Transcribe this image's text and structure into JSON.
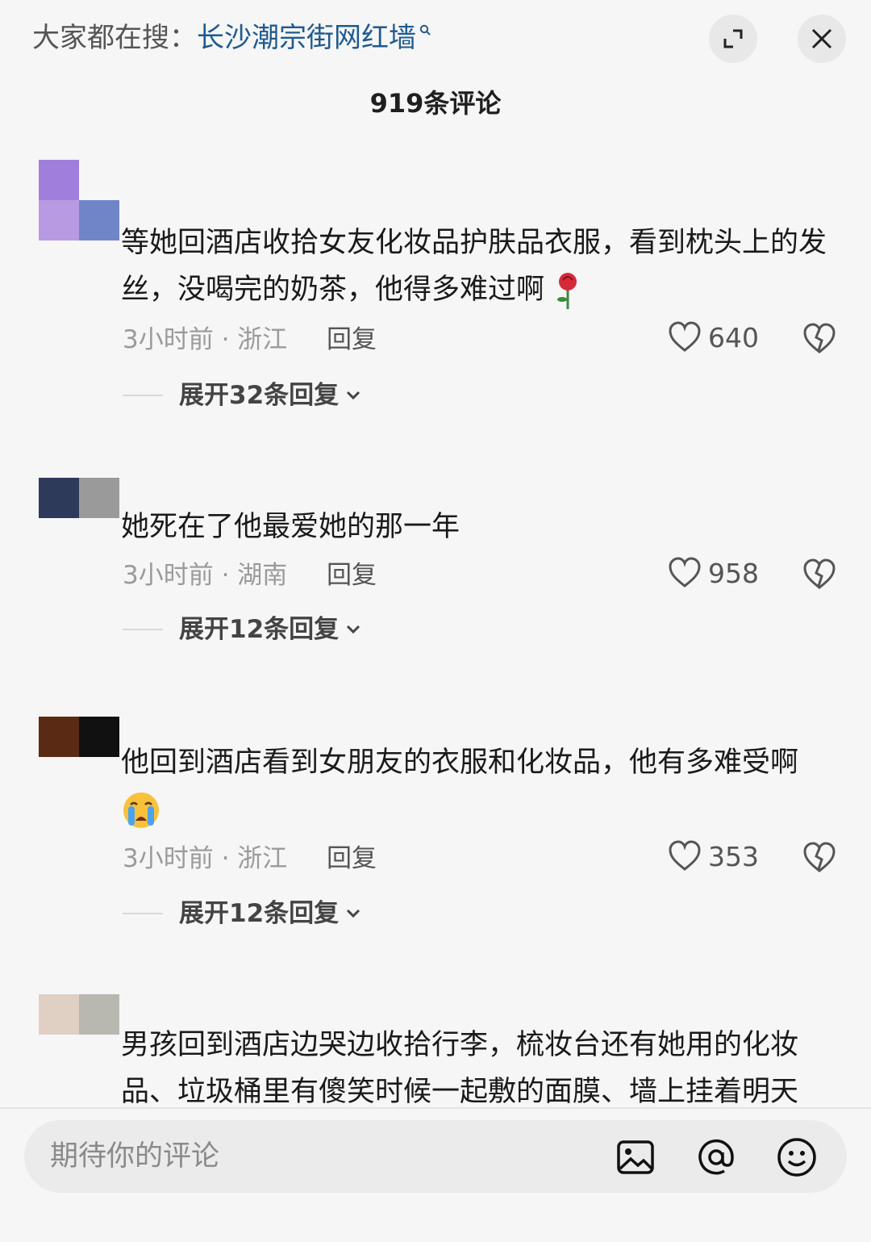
{
  "header": {
    "search_prefix": "大家都在搜：",
    "search_term": "长沙潮宗街网红墙",
    "comment_count_label": "919条评论"
  },
  "comments": [
    {
      "text": "等她回酒店收拾女友化妆品护肤品衣服，看到枕头上的发丝，没喝完的奶茶，他得多难过啊",
      "emoji": "rose-emoji",
      "time_location": "3小时前 · 浙江",
      "reply_label": "回复",
      "likes": "640",
      "expand_label": "展开32条回复",
      "avatar_colors": [
        "#a07fdc",
        "#f6f6f6",
        "#b89ae2",
        "#6f85c8"
      ]
    },
    {
      "text": "她死在了他最爱她的那一年",
      "time_location": "3小时前 · 湖南",
      "reply_label": "回复",
      "likes": "958",
      "expand_label": "展开12条回复",
      "avatar_colors": [
        "#2e3a5a",
        "#9a9a9a",
        "#f6f6f6",
        "#f6f6f6"
      ]
    },
    {
      "text": "他回到酒店看到女朋友的衣服和化妆品，他有多难受啊",
      "emoji": "crying-face-emoji",
      "time_location": "3小时前 · 浙江",
      "reply_label": "回复",
      "likes": "353",
      "expand_label": "展开12条回复",
      "avatar_colors": [
        "#5a2a14",
        "#111111",
        "#f6f6f6",
        "#f6f6f6"
      ]
    },
    {
      "text": "男孩回到酒店边哭边收拾行李，梳妆台还有她用的化妆品、垃圾桶里有傻笑时候一起敷的面膜、墙上挂着明天",
      "avatar_colors": [
        "#e0d0c4",
        "#b8b8b0",
        "#f6f6f6",
        "#f6f6f6"
      ]
    }
  ],
  "bottom_bar": {
    "placeholder": "期待你的评论"
  },
  "colors": {
    "background": "#f6f6f6",
    "link_blue": "#1f5a8f",
    "meta_gray": "#9a9a9a"
  },
  "icons": [
    "search-icon",
    "expand-icon",
    "close-icon",
    "heart-icon",
    "dislike-heart-icon",
    "image-icon",
    "at-icon",
    "emoji-icon"
  ]
}
